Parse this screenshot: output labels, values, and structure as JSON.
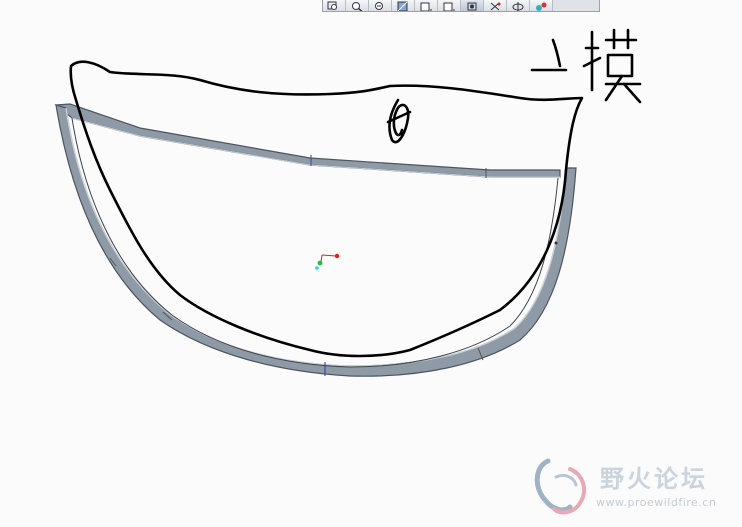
{
  "toolbar": {
    "buttons": [
      {
        "icon": "zoom-window-icon"
      },
      {
        "icon": "zoom-in-icon"
      },
      {
        "icon": "zoom-out-icon"
      },
      {
        "icon": "repaint-icon"
      },
      {
        "icon": "saved-view-icon"
      },
      {
        "icon": "display-style-icon"
      },
      {
        "icon": "view-orientation-icon"
      },
      {
        "icon": "datum-display-icon"
      },
      {
        "icon": "spin-center-icon"
      },
      {
        "icon": "appearance-icon"
      }
    ]
  },
  "annotation": {
    "handwritten_text": "一模"
  },
  "watermark": {
    "title": "野火论坛",
    "url": "www.proewildfire.cn"
  },
  "colors": {
    "background": "#fbfbfb",
    "part_body": "#8e9aa6",
    "part_edge": "#4c5560",
    "sketch_ink": "#000000",
    "csys_x": "#e02020",
    "csys_y": "#20c040",
    "csys_z": "#30d0e0"
  }
}
